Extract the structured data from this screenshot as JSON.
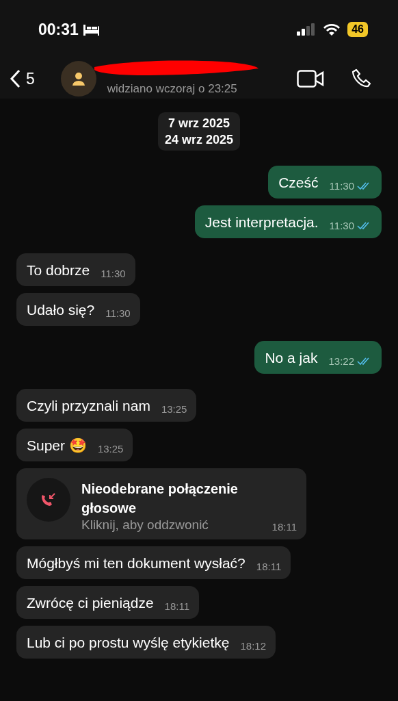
{
  "status_bar": {
    "time": "00:31",
    "battery": "46"
  },
  "header": {
    "back_count": "5",
    "last_seen": "widziano wczoraj o 23:25"
  },
  "date_chip": [
    "7 wrz 2025",
    "24 wrz 2025"
  ],
  "messages": [
    {
      "kind": "text",
      "outgoing": true,
      "text": "Cześć",
      "time": "11:30",
      "read": true
    },
    {
      "kind": "text",
      "outgoing": true,
      "text": "Jest interpretacja.",
      "time": "11:30",
      "read": true
    },
    {
      "kind": "text",
      "outgoing": false,
      "text": "To dobrze",
      "time": "11:30"
    },
    {
      "kind": "text",
      "outgoing": false,
      "text": "Udało się?",
      "time": "11:30"
    },
    {
      "kind": "text",
      "outgoing": true,
      "text": "No a jak",
      "time": "13:22",
      "read": true
    },
    {
      "kind": "text",
      "outgoing": false,
      "text": "Czyli przyznali nam",
      "time": "13:25"
    },
    {
      "kind": "text",
      "outgoing": false,
      "text": "Super 🤩",
      "time": "13:25"
    },
    {
      "kind": "call",
      "outgoing": false,
      "title": "Nieodebrane połączenie głosowe",
      "subtitle": "Kliknij, aby oddzwonić",
      "time": "18:11"
    },
    {
      "kind": "text",
      "outgoing": false,
      "text": "Mógłbyś mi ten dokument wysłać?",
      "time": "18:11"
    },
    {
      "kind": "text",
      "outgoing": false,
      "text": "Zwrócę ci pieniądze",
      "time": "18:11"
    },
    {
      "kind": "text",
      "outgoing": false,
      "text": "Lub ci po prostu wyślę etykietkę",
      "time": "18:12"
    }
  ]
}
